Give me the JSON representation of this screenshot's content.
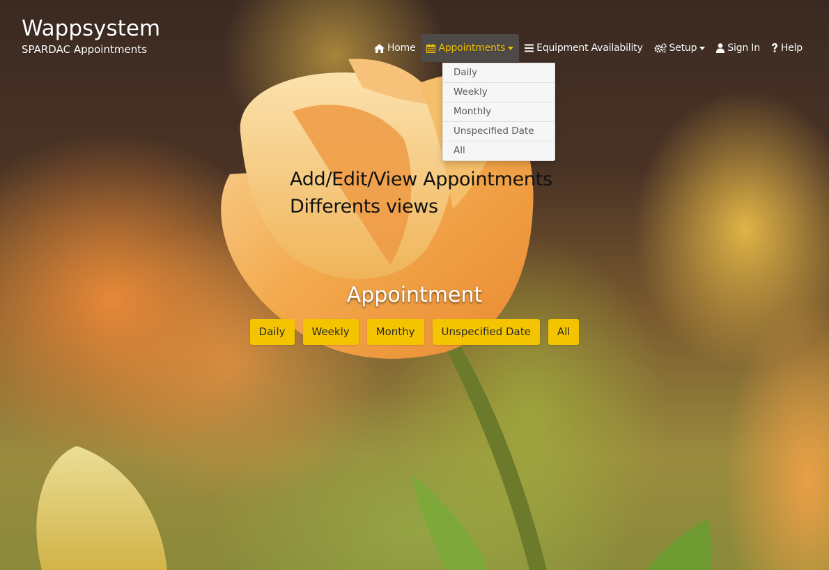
{
  "brand": {
    "title": "Wappsystem",
    "subtitle": "SPARDAC Appointments"
  },
  "nav": {
    "items": [
      {
        "label": "Home",
        "icon": "home-icon"
      },
      {
        "label": "Appointments",
        "icon": "calendar-icon",
        "active": true,
        "has_caret": true
      },
      {
        "label": "Equipment Availability",
        "icon": "list-icon"
      },
      {
        "label": "Setup",
        "icon": "gears-icon",
        "has_caret": true
      },
      {
        "label": "Sign In",
        "icon": "user-icon"
      },
      {
        "label": "Help",
        "icon": "question-icon"
      }
    ]
  },
  "dropdown": {
    "items": [
      "Daily",
      "Weekly",
      "Monthly",
      "Unspecified Date",
      "All"
    ]
  },
  "overlay": {
    "line1": "Add/Edit/View Appointments",
    "line2": "Differents views"
  },
  "section": {
    "title": "Appointment",
    "buttons": [
      "Daily",
      "Weekly",
      "Monthy",
      "Unspecified Date",
      "All"
    ]
  },
  "colors": {
    "accent": "#f5c400",
    "active_nav_bg": "#4d4a48",
    "active_nav_text": "#f2c200"
  }
}
